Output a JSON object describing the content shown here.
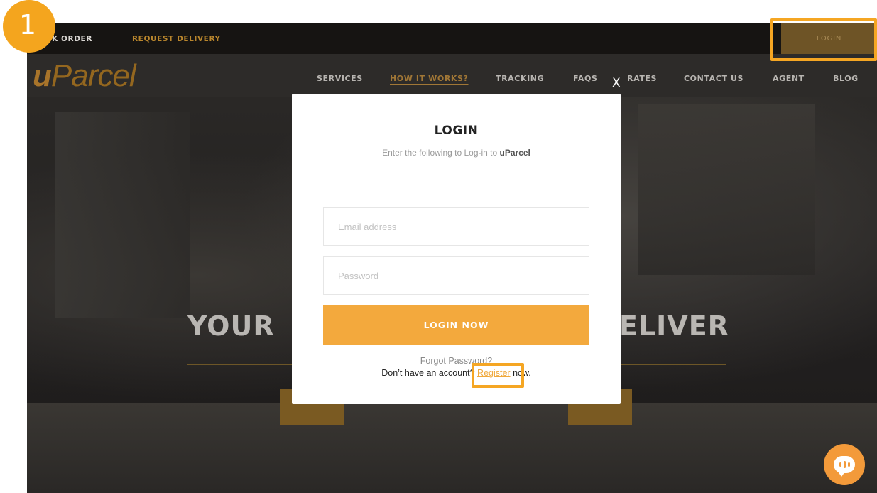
{
  "annotation": {
    "step_number": "1"
  },
  "site": {
    "topbar": {
      "track_order": "ACK ORDER",
      "request_delivery": "REQUEST DELIVERY",
      "login": "LOGIN"
    },
    "logo": {
      "u": "u",
      "rest": "Parcel"
    },
    "nav": {
      "services": "SERVICES",
      "how_it_works": "HOW IT WORKS?",
      "tracking": "TRACKING",
      "faqs": "FAQS",
      "rates": "RATES",
      "contact_us": "CONTACT US",
      "agent": "AGENT",
      "blog": "BLOG"
    },
    "hero": {
      "left": "YOUR",
      "right": "ELIVER"
    }
  },
  "modal": {
    "close": "X",
    "title": "LOGIN",
    "subtitle_prefix": "Enter the following to Log-in to ",
    "subtitle_brand": "uParcel",
    "email_placeholder": "Email address",
    "password_placeholder": "Password",
    "login_button": "LOGIN NOW",
    "forgot": "Forgot Password?",
    "no_account_prefix": "Don’t have an account? ",
    "register": "Register",
    "no_account_suffix": " now."
  },
  "colors": {
    "accent": "#f3a93d",
    "highlight": "#f5a623",
    "modal_bg": "#ffffff"
  },
  "icons": {
    "chat": "chat-bubble-icon",
    "close": "close-icon"
  }
}
